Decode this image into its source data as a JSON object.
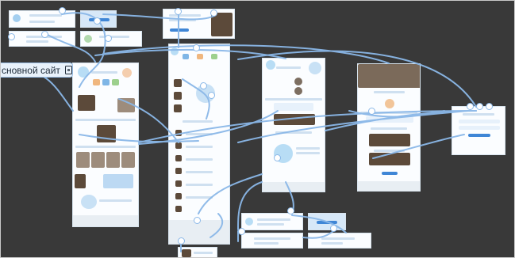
{
  "page_label": {
    "text": "сновной сайт",
    "icon": "page-icon"
  },
  "colors": {
    "canvas": "#393939",
    "connector": "#8bb8e8",
    "accent_blue": "#3f86d6",
    "label_bg": "#e9f2fb"
  },
  "icons": [
    "page-icon",
    "connector-node-icon"
  ]
}
